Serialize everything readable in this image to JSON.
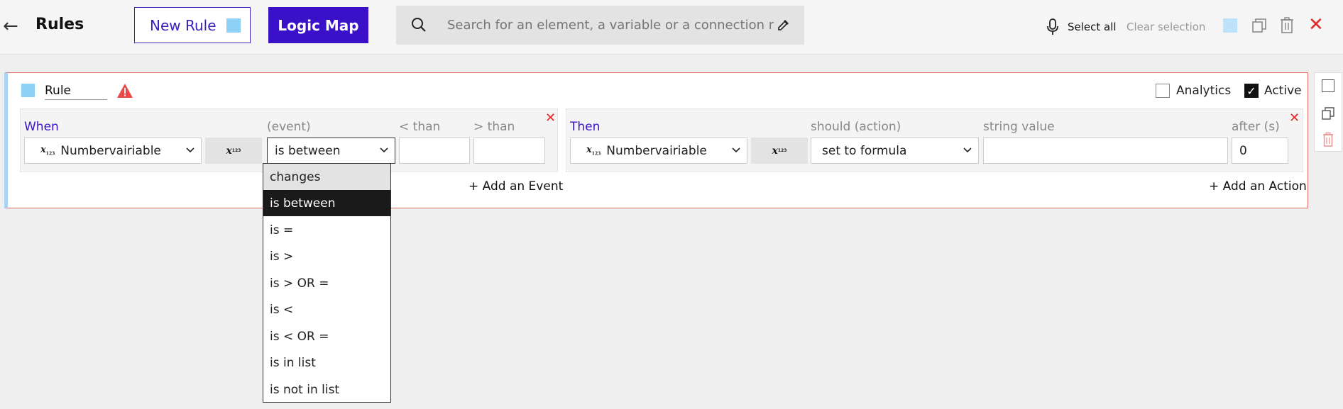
{
  "header": {
    "back_icon": "arrow-left-icon",
    "title": "Rules",
    "new_rule_label": "New Rule",
    "logic_map_label": "Logic Map",
    "search_placeholder": "Search for an element, a variable or a connection name",
    "select_all": "Select all",
    "clear_selection": "Clear selection",
    "accent": "#3a11c9"
  },
  "rule": {
    "name": "Rule",
    "analytics_label": "Analytics",
    "analytics_checked": false,
    "active_label": "Active",
    "active_checked": true,
    "when": {
      "when_label": "When",
      "event_label": "(event)",
      "lt_label": "< than",
      "gt_label": "> than",
      "variable": "Numbervairiable",
      "event_value": "is between",
      "lt_value": "",
      "gt_value": ""
    },
    "then": {
      "then_label": "Then",
      "action_label": "should (action)",
      "string_label": "string value",
      "after_label": "after (s)",
      "variable": "Numbervairiable",
      "action_value": "set to formula",
      "string_value": "",
      "after_value": "0"
    },
    "add_event": "+ Add an Event",
    "add_action": "+ Add an Action"
  },
  "dropdown": {
    "options": [
      "changes",
      "is between",
      "is =",
      "is >",
      "is > OR =",
      "is <",
      "is < OR =",
      "is in list",
      "is not in list"
    ],
    "selected": "is between",
    "hovered": "changes"
  }
}
